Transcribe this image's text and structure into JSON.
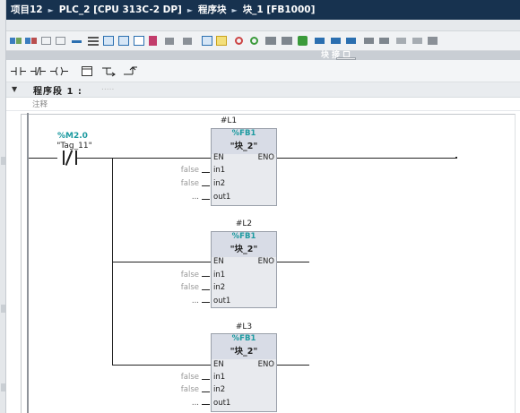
{
  "breadcrumb": [
    "项目12",
    "PLC_2 [CPU 313C-2 DP]",
    "程序块",
    "块_1 [FB1000]"
  ],
  "interface_bar": {
    "label": "块接口"
  },
  "network": {
    "title": "程序段 1 :",
    "comment_placeholder": "注释"
  },
  "contact": {
    "address": "%M2.0",
    "tag": "\"Tag_11\""
  },
  "blocks": [
    {
      "instance": "#L1",
      "fb_number": "%FB1",
      "fb_name": "\"块_2\"",
      "en": "EN",
      "eno": "ENO",
      "in1": "in1",
      "in2": "in2",
      "out1": "out1",
      "in1_value": "false",
      "in2_value": "false",
      "out1_value": "..."
    },
    {
      "instance": "#L2",
      "fb_number": "%FB1",
      "fb_name": "\"块_2\"",
      "en": "EN",
      "eno": "ENO",
      "in1": "in1",
      "in2": "in2",
      "out1": "out1",
      "in1_value": "false",
      "in2_value": "false",
      "out1_value": "..."
    },
    {
      "instance": "#L3",
      "fb_number": "%FB1",
      "fb_name": "\"块_2\"",
      "en": "EN",
      "eno": "ENO",
      "in1": "in1",
      "in2": "in2",
      "out1": "out1",
      "in1_value": "false",
      "in2_value": "false",
      "out1_value": "..."
    }
  ],
  "toolbar_icons": [
    "insert-network-icon",
    "delete-network-icon",
    "insert-row-icon",
    "append-row-icon",
    "network-options-icon",
    "show-comments-icon",
    "hide-comments-icon",
    "favorites-icon",
    "absolute-operands-icon",
    "open-all-networks-icon",
    "close-all-networks-icon",
    "zoom-in-icon",
    "zoom-out-icon",
    "callstruct-icon",
    "monitor-on-icon",
    "monitor-off-icon",
    "compare-icon",
    "cross-reference-icon",
    "go-to-error-icon",
    "go-to-previous-icon",
    "go-to-next-icon",
    "find-icon",
    "replace-icon",
    "download-icon"
  ],
  "ladder_icons": [
    "no-contact-icon",
    "nc-contact-icon",
    "coil-icon",
    "empty-box-icon",
    "open-branch-icon",
    "close-branch-icon"
  ],
  "colors": {
    "title_bg": "#17324f",
    "accent_teal": "#1c9aa0",
    "box_fill": "#d8dce6"
  }
}
